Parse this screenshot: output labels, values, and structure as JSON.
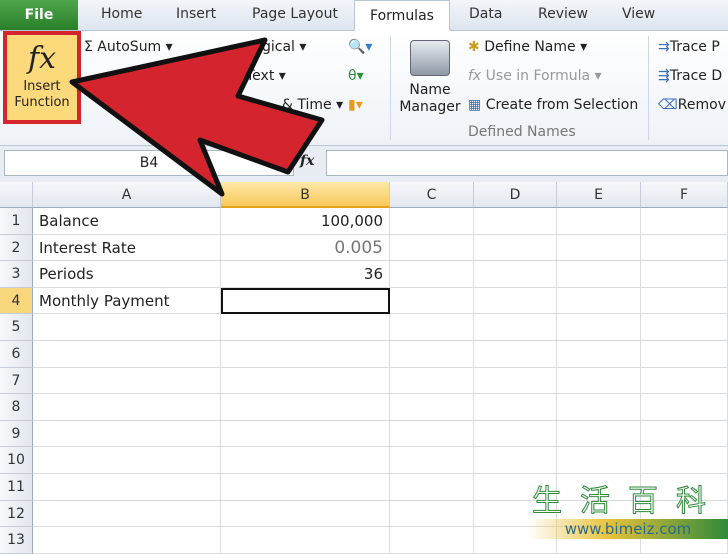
{
  "tabs": {
    "file": "File",
    "items": [
      "Home",
      "Insert",
      "Page Layout",
      "Formulas",
      "Data",
      "Review",
      "View"
    ]
  },
  "ribbon": {
    "insert_function": {
      "icon": "fx",
      "label1": "Insert",
      "label2": "Function"
    },
    "autosum": "AutoSum",
    "logical": "gical",
    "text": "Text",
    "datetime": "& Time",
    "name_manager": [
      "Name",
      "Manager"
    ],
    "define_name": "Define Name",
    "use_in_formula": "Use in Formula",
    "create_from_selection": "Create from Selection",
    "defined_names_group": "Defined Names",
    "trace_precedents": "Trace P",
    "trace_dependents": "Trace D",
    "remove_arrows": "Remov"
  },
  "formula_bar": {
    "name_box": "B4",
    "fx": "fx",
    "value": ""
  },
  "columns": [
    "A",
    "B",
    "C",
    "D",
    "E",
    "F"
  ],
  "rows": [
    {
      "n": "1",
      "a": "Balance",
      "b": "100,000"
    },
    {
      "n": "2",
      "a": "Interest Rate",
      "b": "0.005"
    },
    {
      "n": "3",
      "a": "Periods",
      "b": "36"
    },
    {
      "n": "4",
      "a": "Monthly Payment",
      "b": ""
    },
    {
      "n": "5"
    },
    {
      "n": "6"
    },
    {
      "n": "7"
    },
    {
      "n": "8"
    },
    {
      "n": "9"
    },
    {
      "n": "10"
    },
    {
      "n": "11"
    },
    {
      "n": "12"
    },
    {
      "n": "13"
    }
  ],
  "selected_cell": "B4",
  "annotation_color": "#d4252e",
  "watermark": {
    "chars": "生活百科",
    "url": "www.bimeiz.com"
  }
}
